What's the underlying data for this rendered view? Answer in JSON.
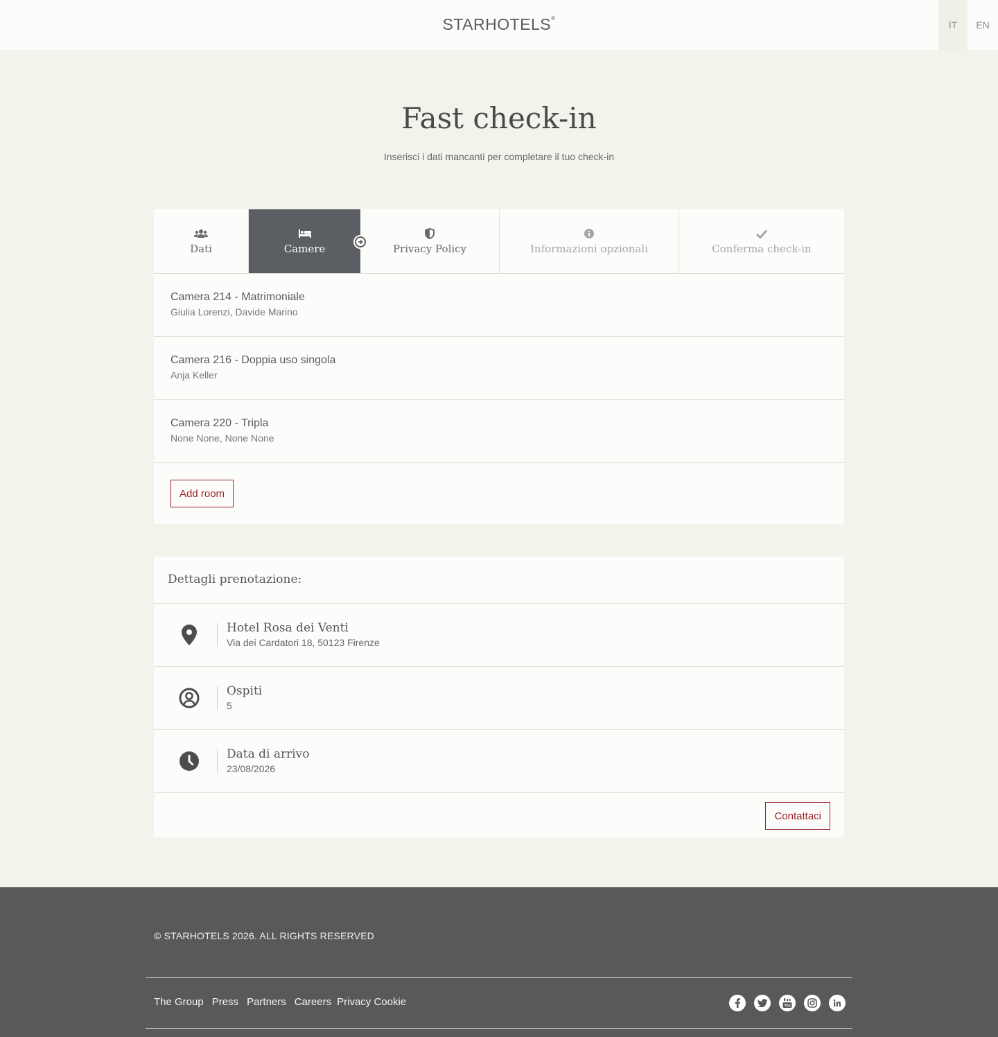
{
  "header": {
    "logo": "STARHOTELS",
    "languages": [
      "IT",
      "EN"
    ]
  },
  "page": {
    "title": "Fast check-in",
    "subtitle": "Inserisci i dati mancanti per completare il tuo check-in"
  },
  "steps": [
    {
      "label": "Dati",
      "icon": "users-icon"
    },
    {
      "label": "Camere",
      "icon": "bed-icon"
    },
    {
      "label": "Privacy Policy",
      "icon": "shield-icon"
    },
    {
      "label": "Informazioni opzionali",
      "icon": "info-icon"
    },
    {
      "label": "Conferma check-in",
      "icon": "check-icon"
    }
  ],
  "rooms": [
    {
      "title": "Camera 214 - Matrimoniale",
      "guests": "Giulia Lorenzi, Davide Marino"
    },
    {
      "title": "Camera 216 - Doppia uso singola",
      "guests": "Anja Keller"
    },
    {
      "title": "Camera 220 - Tripla",
      "guests": "None None, None None"
    }
  ],
  "add_room_label": "Add room",
  "details": {
    "heading": "Dettagli prenotazione:",
    "hotel_name": "Hotel Rosa dei Venti",
    "hotel_address": "Via dei Cardatori 18, 50123 Firenze",
    "guests_label": "Ospiti",
    "guests_value": "5",
    "arrival_label": "Data di arrivo",
    "arrival_value": "23/08/2026",
    "contact_label": "Contattaci"
  },
  "footer": {
    "copyright": "© STARHOTELS 2026. ALL RIGHTS RESERVED",
    "links": [
      "The Group",
      "Press",
      "Partners",
      "Careers",
      "Privacy Cookie"
    ],
    "socials": [
      "facebook-icon",
      "twitter-icon",
      "youtube-icon",
      "instagram-icon",
      "linkedin-icon"
    ]
  },
  "colors": {
    "background": "#f3f2eb",
    "panel": "#fcfcfa",
    "active_step": "#5b5e62",
    "accent": "#9b2226",
    "footer": "#58595b"
  }
}
